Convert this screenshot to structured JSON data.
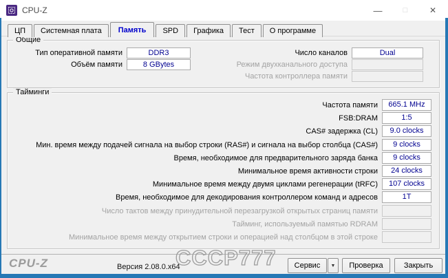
{
  "window": {
    "title": "CPU-Z",
    "icons": {
      "minimize": "—",
      "maximize": "□",
      "close": "✕",
      "service_dropdown": "▼"
    }
  },
  "tabs": [
    {
      "label": "ЦП",
      "active": false
    },
    {
      "label": "Системная плата",
      "active": false
    },
    {
      "label": "Память",
      "active": true
    },
    {
      "label": "SPD",
      "active": false
    },
    {
      "label": "Графика",
      "active": false
    },
    {
      "label": "Тест",
      "active": false
    },
    {
      "label": "О программе",
      "active": false
    }
  ],
  "general": {
    "title": "Общие",
    "left": [
      {
        "label": "Тип оперативной памяти",
        "value": "DDR3"
      },
      {
        "label": "Объём памяти",
        "value": "8 GBytes"
      }
    ],
    "right": [
      {
        "label": "Число каналов",
        "value": "Dual",
        "enabled": true
      },
      {
        "label": "Режим двухканального доступа",
        "value": "",
        "enabled": false
      },
      {
        "label": "Частота контроллера памяти",
        "value": "",
        "enabled": false
      }
    ]
  },
  "timings": {
    "title": "Тайминги",
    "rows": [
      {
        "label": "Частота памяти",
        "value": "665.1 MHz",
        "enabled": true
      },
      {
        "label": "FSB:DRAM",
        "value": "1:5",
        "enabled": true
      },
      {
        "label": "CAS# задержка (CL)",
        "value": "9.0 clocks",
        "enabled": true
      },
      {
        "label": "Мин. время между подачей сигнала на выбор строки (RAS#) и сигнала на выбор столбца (CAS#)",
        "value": "9 clocks",
        "enabled": true
      },
      {
        "label": "Время, необходимое для предварительного заряда банка",
        "value": "9 clocks",
        "enabled": true
      },
      {
        "label": "Минимальное время активности строки",
        "value": "24 clocks",
        "enabled": true
      },
      {
        "label": "Минимальное время между двумя циклами регенерации (tRFC)",
        "value": "107 clocks",
        "enabled": true
      },
      {
        "label": "Время, необходимое для декодирования контроллером команд и адресов",
        "value": "1T",
        "enabled": true
      },
      {
        "label": "Число тактов между принудительной перезагрузкой открытых страниц памяти",
        "value": "",
        "enabled": false
      },
      {
        "label": "Тайминг, используемый памятью RDRAM",
        "value": "",
        "enabled": false
      },
      {
        "label": "Минимальное время между открытием строки и операцией над столбцом в этой строке",
        "value": "",
        "enabled": false
      }
    ]
  },
  "footer": {
    "logo": "CPU-Z",
    "version": "Версия 2.08.0.x64",
    "watermark": "СССР777",
    "buttons": {
      "service": "Сервис",
      "validate": "Проверка",
      "close": "Закрыть"
    }
  },
  "colors": {
    "accent_border": "#2678b5",
    "value_text": "#000090",
    "active_tab_text": "#0000cc"
  }
}
